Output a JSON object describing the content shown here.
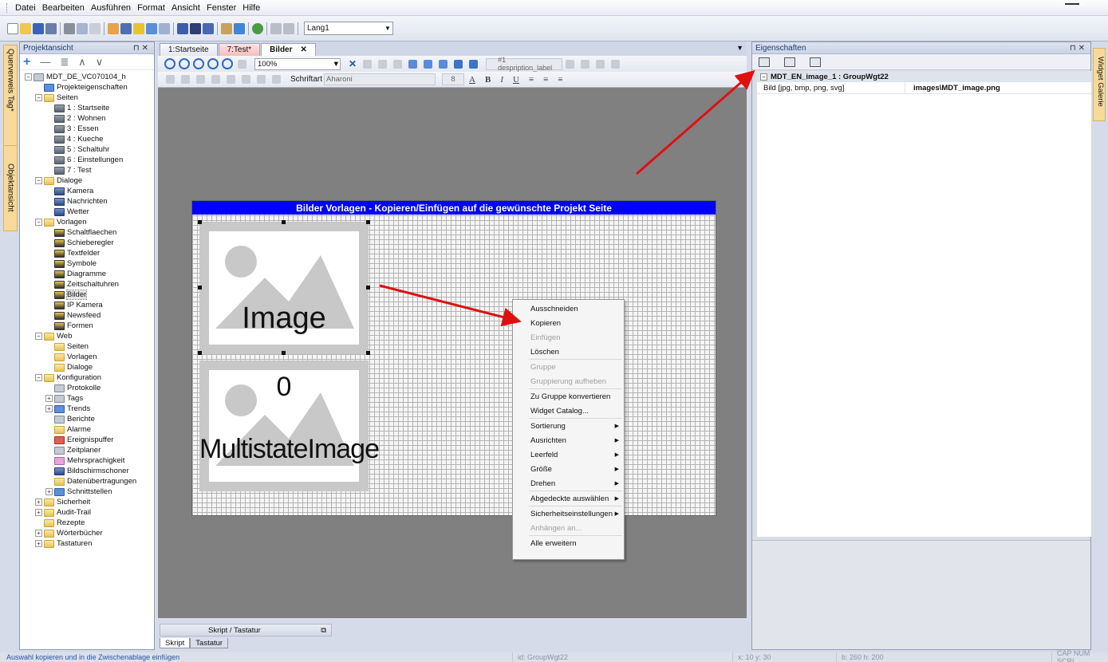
{
  "menu": [
    "Datei",
    "Bearbeiten",
    "Ausführen",
    "Format",
    "Ansicht",
    "Fenster",
    "Hilfe"
  ],
  "toolbar": {
    "language": "Lang1"
  },
  "side_tabs": {
    "left_top": "Querverweis Tag*",
    "left_bottom": "Objektansicht",
    "right": "Widget Galerie"
  },
  "project_panel": {
    "title": "Projektansicht",
    "tree": [
      {
        "label": "MDT_DE_VC070104_h",
        "level": 0,
        "exp": "-",
        "icon": "gray"
      },
      {
        "label": "Projekteigenschaften",
        "level": 1,
        "exp": "",
        "icon": "blue"
      },
      {
        "label": "Seiten",
        "level": 1,
        "exp": "-",
        "icon": "folder"
      },
      {
        "label": "1 : Startseite",
        "level": 2,
        "exp": "",
        "icon": "page"
      },
      {
        "label": "2 : Wohnen",
        "level": 2,
        "exp": "",
        "icon": "page"
      },
      {
        "label": "3 : Essen",
        "level": 2,
        "exp": "",
        "icon": "page"
      },
      {
        "label": "4 : Kueche",
        "level": 2,
        "exp": "",
        "icon": "page"
      },
      {
        "label": "5 : Schaltuhr",
        "level": 2,
        "exp": "",
        "icon": "page"
      },
      {
        "label": "6 : Einstellungen",
        "level": 2,
        "exp": "",
        "icon": "page"
      },
      {
        "label": "7 : Test",
        "level": 2,
        "exp": "",
        "icon": "page"
      },
      {
        "label": "Dialoge",
        "level": 1,
        "exp": "-",
        "icon": "folder"
      },
      {
        "label": "Kamera",
        "level": 2,
        "exp": "",
        "icon": "dialog"
      },
      {
        "label": "Nachrichten",
        "level": 2,
        "exp": "",
        "icon": "dialog"
      },
      {
        "label": "Wetter",
        "level": 2,
        "exp": "",
        "icon": "dialog"
      },
      {
        "label": "Vorlagen",
        "level": 1,
        "exp": "-",
        "icon": "folder"
      },
      {
        "label": "Schaltflaechen",
        "level": 2,
        "exp": "",
        "icon": "tmpl"
      },
      {
        "label": "Schieberegler",
        "level": 2,
        "exp": "",
        "icon": "tmpl"
      },
      {
        "label": "Textfelder",
        "level": 2,
        "exp": "",
        "icon": "tmpl"
      },
      {
        "label": "Symbole",
        "level": 2,
        "exp": "",
        "icon": "tmpl"
      },
      {
        "label": "Diagramme",
        "level": 2,
        "exp": "",
        "icon": "tmpl"
      },
      {
        "label": "Zeitschaltuhren",
        "level": 2,
        "exp": "",
        "icon": "tmpl"
      },
      {
        "label": "Bilder",
        "level": 2,
        "exp": "",
        "icon": "tmpl",
        "selected": true
      },
      {
        "label": "IP Kamera",
        "level": 2,
        "exp": "",
        "icon": "tmpl"
      },
      {
        "label": "Newsfeed",
        "level": 2,
        "exp": "",
        "icon": "tmpl"
      },
      {
        "label": "Formen",
        "level": 2,
        "exp": "",
        "icon": "tmpl"
      },
      {
        "label": "Web",
        "level": 1,
        "exp": "-",
        "icon": "folder"
      },
      {
        "label": "Seiten",
        "level": 2,
        "exp": "",
        "icon": "folder"
      },
      {
        "label": "Vorlagen",
        "level": 2,
        "exp": "",
        "icon": "folder"
      },
      {
        "label": "Dialoge",
        "level": 2,
        "exp": "",
        "icon": "folder"
      },
      {
        "label": "Konfiguration",
        "level": 1,
        "exp": "-",
        "icon": "folder"
      },
      {
        "label": "Protokolle",
        "level": 2,
        "exp": "",
        "icon": "gray"
      },
      {
        "label": "Tags",
        "level": 2,
        "exp": "+",
        "icon": "gray"
      },
      {
        "label": "Trends",
        "level": 2,
        "exp": "+",
        "icon": "blue"
      },
      {
        "label": "Berichte",
        "level": 2,
        "exp": "",
        "icon": "gray"
      },
      {
        "label": "Alarme",
        "level": 2,
        "exp": "",
        "icon": "folder"
      },
      {
        "label": "Ereignispuffer",
        "level": 2,
        "exp": "",
        "icon": "red"
      },
      {
        "label": "Zeitplaner",
        "level": 2,
        "exp": "",
        "icon": "gray"
      },
      {
        "label": "Mehrsprachigkeit",
        "level": 2,
        "exp": "",
        "icon": "pink"
      },
      {
        "label": "Bildschirmschoner",
        "level": 2,
        "exp": "",
        "icon": "dialog"
      },
      {
        "label": "Datenübertragungen",
        "level": 2,
        "exp": "",
        "icon": "folder"
      },
      {
        "label": "Schnittstellen",
        "level": 2,
        "exp": "+",
        "icon": "blue"
      },
      {
        "label": "Sicherheit",
        "level": 1,
        "exp": "+",
        "icon": "folder"
      },
      {
        "label": "Audit-Trail",
        "level": 1,
        "exp": "+",
        "icon": "folder"
      },
      {
        "label": "Rezepte",
        "level": 1,
        "exp": "",
        "icon": "folder"
      },
      {
        "label": "Wörterbücher",
        "level": 1,
        "exp": "+",
        "icon": "folder"
      },
      {
        "label": "Tastaturen",
        "level": 1,
        "exp": "+",
        "icon": "folder"
      }
    ]
  },
  "doc_tabs": [
    {
      "label": "1:Startseite",
      "style": ""
    },
    {
      "label": "7:Test*",
      "style": "pink"
    },
    {
      "label": "Bilder",
      "style": "active"
    }
  ],
  "editor": {
    "zoom": "100%",
    "label_field": "#1 despription_label",
    "font_label": "Schriftart",
    "font_value": "Aharoni",
    "font_size": "8"
  },
  "canvas": {
    "title": "Bilder Vorlagen -  Kopieren/Einfügen auf die gewünschte Projekt Seite",
    "image_label": "Image",
    "multistate_value": "0",
    "multistate_label": "MultistateImage"
  },
  "context_menu": [
    {
      "label": "Ausschneiden",
      "disabled": false,
      "sub": false
    },
    {
      "label": "Kopieren",
      "disabled": false,
      "sub": false
    },
    {
      "label": "Einfügen",
      "disabled": true,
      "sub": false
    },
    {
      "label": "Löschen",
      "disabled": false,
      "sub": false
    },
    {
      "sep": true
    },
    {
      "label": "Gruppe",
      "disabled": true,
      "sub": false
    },
    {
      "label": "Gruppierung aufheben",
      "disabled": true,
      "sub": false
    },
    {
      "sep": true
    },
    {
      "label": "Zu Gruppe konvertieren",
      "disabled": false,
      "sub": false
    },
    {
      "label": "Widget Catalog...",
      "disabled": false,
      "sub": false
    },
    {
      "sep": true
    },
    {
      "label": "Sortierung",
      "disabled": false,
      "sub": true
    },
    {
      "label": "Ausrichten",
      "disabled": false,
      "sub": true
    },
    {
      "label": "Leerfeld",
      "disabled": false,
      "sub": true
    },
    {
      "label": "Größe",
      "disabled": false,
      "sub": true
    },
    {
      "label": "Drehen",
      "disabled": false,
      "sub": true
    },
    {
      "sep": true
    },
    {
      "label": "Abgedeckte auswählen",
      "disabled": false,
      "sub": true
    },
    {
      "sep": true
    },
    {
      "label": "Sicherheitseinstellungen",
      "disabled": false,
      "sub": true
    },
    {
      "label": "Anhängen an...",
      "disabled": true,
      "sub": false
    },
    {
      "sep": true
    },
    {
      "label": "Alle erweitern",
      "disabled": false,
      "sub": false
    }
  ],
  "bottom_panel": {
    "title": "Skript / Tastatur",
    "tabs": [
      "Skript",
      "Tastatur"
    ]
  },
  "properties_panel": {
    "title": "Eigenschaften",
    "category": "MDT_EN_image_1 : GroupWgt22",
    "rows": [
      {
        "key": "Bild [jpg, bmp, png, svg]",
        "value": "images\\MDT_image.png"
      }
    ]
  },
  "statusbar": {
    "message": "Auswahl kopieren und in die Zwischenablage einfügen",
    "id": "id:  GroupWgt22",
    "pos": "x:  10    y:  30",
    "size": "b:  260    h:  200",
    "keys": "CAP  NUM  SCRL"
  }
}
